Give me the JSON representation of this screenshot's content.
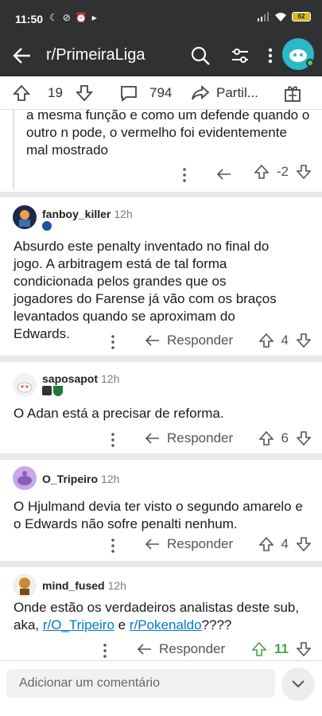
{
  "status": {
    "time": "11:50",
    "battery": "62"
  },
  "appbar": {
    "title": "r/PrimeiraLiga"
  },
  "post_bar": {
    "upvotes": "19",
    "comments": "794",
    "share_label": "Partil..."
  },
  "partial_comment": {
    "text": "a mesma função e como um defende quando o outro n pode, o vermelho foi evidentemente mal mostrado",
    "score": "-2"
  },
  "comments": [
    {
      "author": "fanboy_killer",
      "age": "12h",
      "text": "Absurdo este penalty inventado no final do jogo. A arbitragem está de tal forma condicionada pelos grandes que os jogadores do Farense já vão com os braços levantados quando se aproximam do Edwards.",
      "reply_label": "Responder",
      "score": "4"
    },
    {
      "author": "saposapot",
      "age": "12h",
      "text": "O Adan está a precisar de reforma.",
      "reply_label": "Responder",
      "score": "6"
    },
    {
      "author": "O_Tripeiro",
      "age": "12h",
      "text": "O Hjulmand devia ter visto o segundo amarelo e o Edwards não sofre penalti nenhum.",
      "reply_label": "Responder",
      "score": "4"
    },
    {
      "author": "mind_fused",
      "age": "12h",
      "text_before": "Onde estão os verdadeiros analistas deste sub, aka, ",
      "link1": "r/O_Tripeiro",
      "text_mid": " e ",
      "link2": "r/Pokenaldo",
      "text_after": "????",
      "reply_label": "Responder",
      "score": "11"
    }
  ],
  "composer": {
    "placeholder": "Adicionar um comentário"
  },
  "colors": {
    "bar_bg": "#2f3133",
    "link": "#0079d3",
    "upvoted": "#46a346",
    "avatar": "#2bb8c9"
  }
}
